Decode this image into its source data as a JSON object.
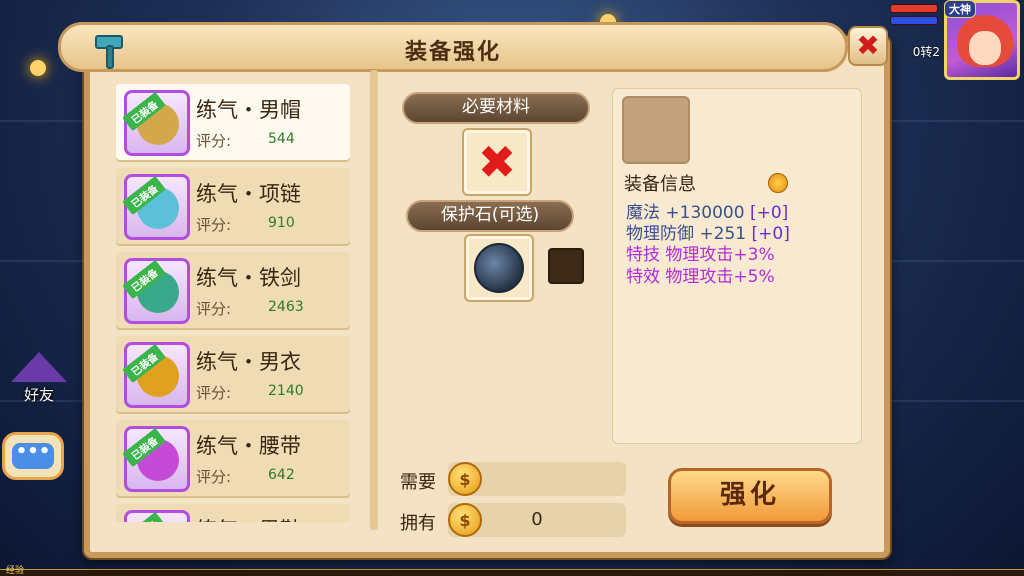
{
  "hud": {
    "rank_text": "0转2",
    "badge_text": "大神",
    "colors": {
      "hp": "#e53a2c",
      "mp": "#2c4fe5"
    }
  },
  "side": {
    "friend_label": "好友",
    "chat_icon_text": "•••"
  },
  "xp_label": "经验",
  "panel": {
    "title": "装备强化",
    "close_label": "✖"
  },
  "equipment_list": [
    {
      "name": "练气・男帽",
      "score_label": "评分:",
      "score": "544",
      "badge": "已装备",
      "art_color": "#d4a84a",
      "selected": true
    },
    {
      "name": "练气・项链",
      "score_label": "评分:",
      "score": "910",
      "badge": "已装备",
      "art_color": "#5bc0d8",
      "selected": false
    },
    {
      "name": "练气・铁剑",
      "score_label": "评分:",
      "score": "2463",
      "badge": "已装备",
      "art_color": "#3aa88a",
      "selected": false
    },
    {
      "name": "练气・男衣",
      "score_label": "评分:",
      "score": "2140",
      "badge": "已装备",
      "art_color": "#e0a020",
      "selected": false
    },
    {
      "name": "练气・腰带",
      "score_label": "评分:",
      "score": "642",
      "badge": "已装备",
      "art_color": "#c64ad8",
      "selected": false
    },
    {
      "name": "练气・男鞋",
      "score_label": "评分:",
      "score": "",
      "badge": "已装备",
      "art_color": "#b14ee0",
      "selected": false
    }
  ],
  "materials": {
    "required_label": "必要材料",
    "required_slot": "✖",
    "protect_label": "保护石(可选)"
  },
  "info": {
    "title": "装备信息",
    "stats": [
      {
        "text": "魔法 +130000",
        "bonus": "[+0]",
        "special": false
      },
      {
        "text": "物理防御 +251",
        "bonus": "[+0]",
        "special": false
      },
      {
        "text": "特技 物理攻击+3%",
        "bonus": "",
        "special": true
      },
      {
        "text": "特效 物理攻击+5%",
        "bonus": "",
        "special": true
      }
    ]
  },
  "cost": {
    "need_label": "需要",
    "need_value": "",
    "own_label": "拥有",
    "own_value": "0",
    "coin_symbol": "$"
  },
  "strengthen_label": "强化"
}
